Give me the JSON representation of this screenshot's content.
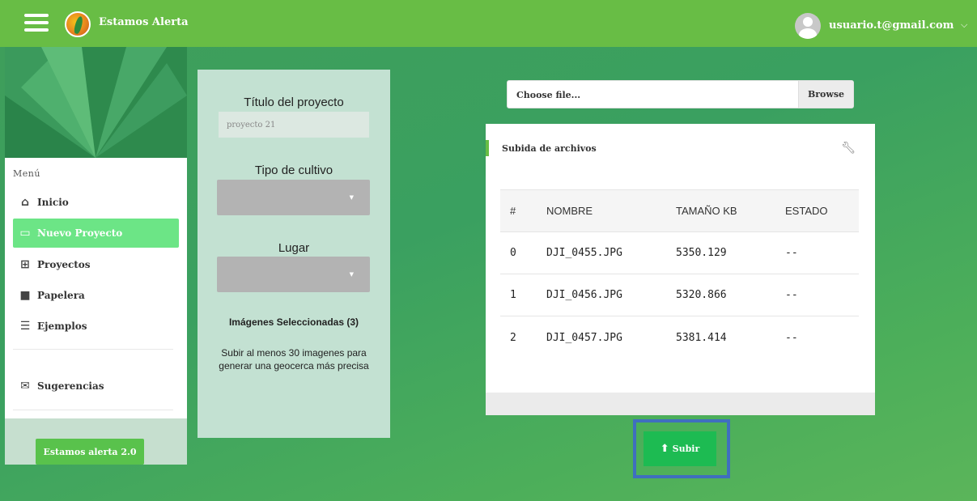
{
  "header": {
    "brand": "Estamos Alerta",
    "user_email": "usuario.t@gmail.com"
  },
  "sidebar": {
    "menu_label": "Menú",
    "items": [
      {
        "label": "Inicio",
        "icon": "home-icon"
      },
      {
        "label": "Nuevo Proyecto",
        "icon": "new-project-icon",
        "active": true
      },
      {
        "label": "Proyectos",
        "icon": "grid-icon"
      },
      {
        "label": "Papelera",
        "icon": "trash-grid-icon"
      },
      {
        "label": "Ejemplos",
        "icon": "list-icon"
      },
      {
        "label": "Sugerencias",
        "icon": "envelope-icon"
      }
    ],
    "footer_button": "Estamos alerta 2.0"
  },
  "form": {
    "title_label": "Título del proyecto",
    "title_value": "proyecto 21",
    "crop_label": "Tipo de cultivo",
    "place_label": "Lugar",
    "selected_images": "Imágenes Seleccionadas (3)",
    "hint": "Subir al menos 30 imagenes para generar una geocerca más precisa"
  },
  "file_input": {
    "placeholder": "Choose file...",
    "browse_label": "Browse"
  },
  "upload_card": {
    "title": "Subida de archivos",
    "columns": [
      "#",
      "NOMBRE",
      "TAMAÑO KB",
      "ESTADO"
    ],
    "rows": [
      [
        "0",
        "DJI_0455.JPG",
        "5350.129",
        "--"
      ],
      [
        "1",
        "DJI_0456.JPG",
        "5320.866",
        "--"
      ],
      [
        "2",
        "DJI_0457.JPG",
        "5381.414",
        "--"
      ]
    ]
  },
  "actions": {
    "upload_label": "Subir"
  },
  "colors": {
    "topbar": "#68bd45",
    "active_menu": "#6ce586",
    "upload_button": "#1dbb52",
    "highlight_frame": "#3f6fbf"
  }
}
